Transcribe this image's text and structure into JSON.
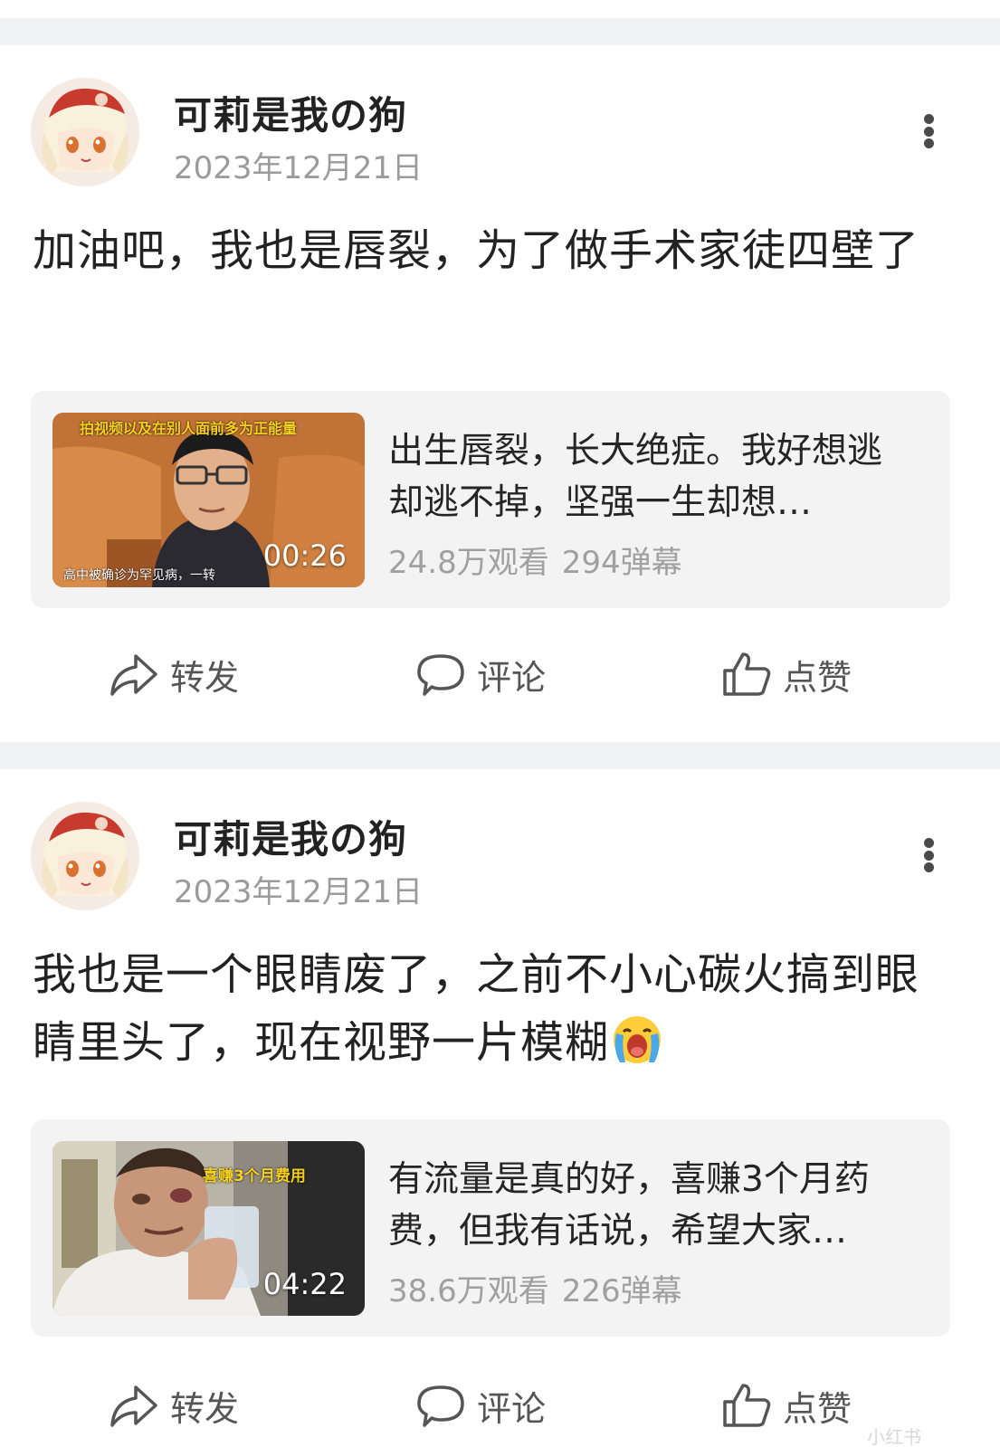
{
  "posts": [
    {
      "author": "可莉是我の狗",
      "date": "2023年12月21日",
      "content": "加油吧，我也是唇裂，为了做手术家徒四壁了",
      "video": {
        "banner_text": "拍视频以及在别人面前多为正能量",
        "caption_text": "高中被确诊为罕见病，一转",
        "duration": "00:26",
        "title": "出生唇裂，长大绝症。我好想逃却逃不掉，坚强一生却想…",
        "views": "24.8万观看",
        "danmaku": "294弹幕"
      }
    },
    {
      "author": "可莉是我の狗",
      "date": "2023年12月21日",
      "content": "我也是一个眼睛废了，之前不小心碳火搞到眼睛里头了，现在视野一片模糊",
      "emoji": "crying-face-emoji",
      "video": {
        "banner_text": "喜赚3个月费用",
        "duration": "04:22",
        "title": "有流量是真的好，喜赚3个月药费，但我有话说，希望大家…",
        "views": "38.6万观看",
        "danmaku": "226弹幕"
      }
    }
  ],
  "actions": {
    "share": "转发",
    "comment": "评论",
    "like": "点赞"
  },
  "watermark": "小红书",
  "colors": {
    "divider": "#f1f2f4",
    "card_bg": "#f3f3f4",
    "meta_text": "#9b9b9b",
    "banner_yellow": "#f5d020"
  }
}
